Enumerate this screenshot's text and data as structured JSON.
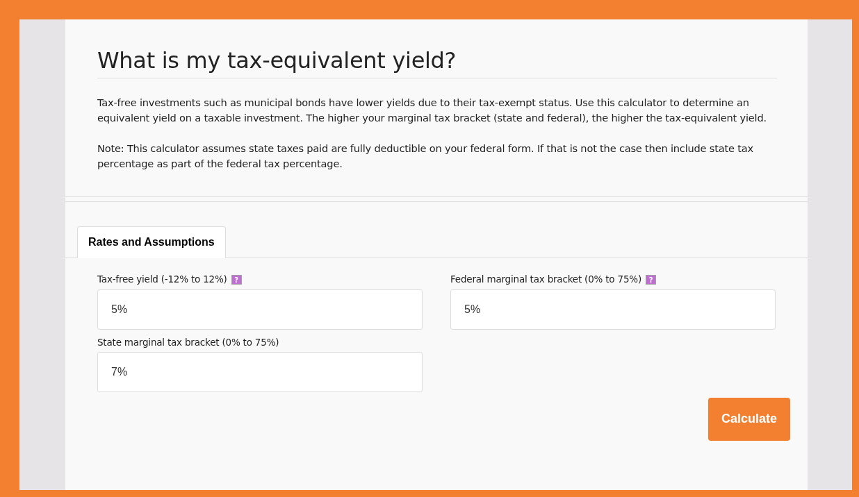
{
  "title": "What is my tax-equivalent yield?",
  "paragraphs": [
    "Tax-free investments such as municipal bonds have lower yields due to their tax-exempt status. Use this calculator to determine an equivalent yield on a taxable investment. The higher your marginal tax bracket (state and federal), the higher the tax-equivalent yield.",
    "Note: This calculator assumes state taxes paid are fully deductible on your federal form. If that is not the case then include state tax percentage as part of the federal tax percentage."
  ],
  "tabs": [
    {
      "label": "Rates and Assumptions",
      "selected": true
    }
  ],
  "fields": [
    {
      "label": "Tax-free yield (-12% to 12%)",
      "help": "?",
      "value": "5%"
    },
    {
      "label": "Federal marginal tax bracket (0% to 75%)",
      "help": "?",
      "value": "5%"
    },
    {
      "label": "State marginal tax bracket (0% to 75%)",
      "value": "7%"
    }
  ],
  "button": "Calculate"
}
